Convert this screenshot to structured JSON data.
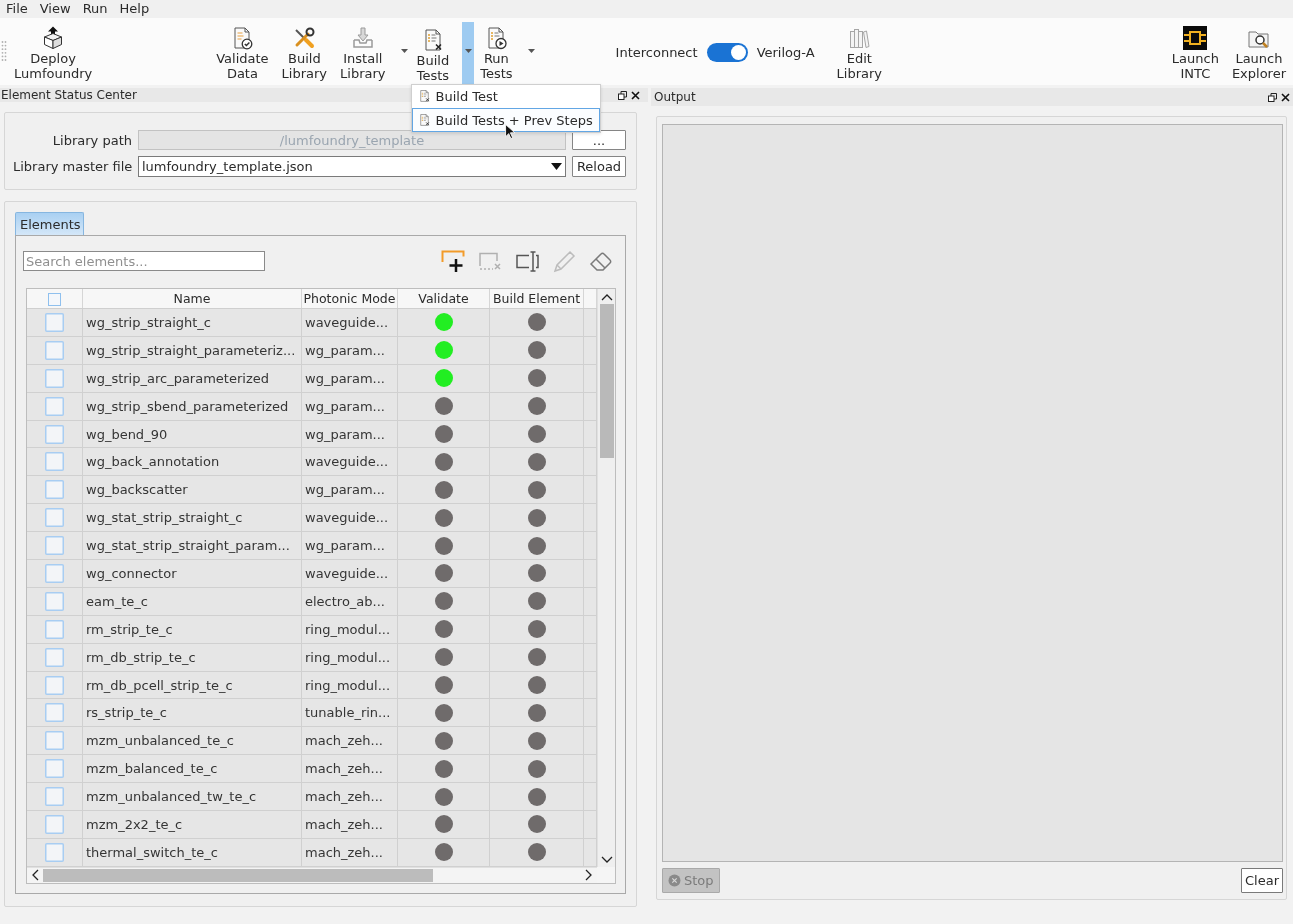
{
  "menu_bar": [
    {
      "label": "File"
    },
    {
      "label": "View"
    },
    {
      "label": "Run"
    },
    {
      "label": "Help"
    }
  ],
  "toolbar": {
    "items": [
      {
        "kind": "button",
        "label": "Deploy Lumfoundry"
      },
      {
        "kind": "button",
        "label": "Validate Data"
      },
      {
        "kind": "button",
        "label": "Build Library"
      },
      {
        "kind": "split",
        "label": "Install Library",
        "expanded": false
      },
      {
        "kind": "split",
        "label": "Build Tests",
        "expanded": true,
        "menu": [
          {
            "label": "Build Test",
            "selected": false
          },
          {
            "label": "Build Tests + Prev Steps",
            "selected": true
          }
        ]
      },
      {
        "kind": "split",
        "label": "Run Tests",
        "expanded": false
      },
      {
        "kind": "toggle",
        "left_label": "Interconnect",
        "right_label": "Verilog-A",
        "on": true
      },
      {
        "kind": "button",
        "label": "Edit Library"
      },
      {
        "kind": "button",
        "label": "Launch INTC"
      },
      {
        "kind": "button",
        "label": "Launch Explorer"
      }
    ]
  },
  "element_status_center": {
    "title": "Element Status Center",
    "library": {
      "path_label": "Library path",
      "path_field": {
        "value": "/lumfoundry_template",
        "disabled": true
      },
      "browse_button": "...",
      "master_label": "Library master file",
      "master_value": "lumfoundry_template.json",
      "reload_button": "Reload"
    },
    "elements": {
      "tabs": [
        {
          "label": "Elements",
          "selected": true
        }
      ],
      "search": {
        "placeholder": "Search elements..."
      },
      "tools": [
        {
          "disabled": false
        },
        {
          "disabled": true
        },
        {
          "disabled": false
        },
        {
          "disabled": true
        },
        {
          "disabled": false
        }
      ],
      "table": {
        "columns": [
          {
            "kind": "check",
            "checked": false
          },
          {
            "kind": "text",
            "label": "Name"
          },
          {
            "kind": "text",
            "label": "Photonic Mode"
          },
          {
            "kind": "status",
            "label": "Validate"
          },
          {
            "kind": "status",
            "label": "Build Element"
          }
        ],
        "rows": [
          {
            "checked": false,
            "name": "wg_strip_straight_c",
            "model": "waveguide...",
            "validate": {
              "color": "#22ee22"
            },
            "build": {
              "color": "#6f6b6b"
            }
          },
          {
            "checked": false,
            "name": "wg_strip_straight_parameteriz...",
            "model": "wg_param...",
            "validate": {
              "color": "#22ee22"
            },
            "build": {
              "color": "#6f6b6b"
            }
          },
          {
            "checked": false,
            "name": "wg_strip_arc_parameterized",
            "model": "wg_param...",
            "validate": {
              "color": "#22ee22"
            },
            "build": {
              "color": "#6f6b6b"
            }
          },
          {
            "checked": false,
            "name": "wg_strip_sbend_parameterized",
            "model": "wg_param...",
            "validate": {
              "color": "#6f6b6b"
            },
            "build": {
              "color": "#6f6b6b"
            }
          },
          {
            "checked": false,
            "name": "wg_bend_90",
            "model": "wg_param...",
            "validate": {
              "color": "#6f6b6b"
            },
            "build": {
              "color": "#6f6b6b"
            }
          },
          {
            "checked": false,
            "name": "wg_back_annotation",
            "model": "waveguide...",
            "validate": {
              "color": "#6f6b6b"
            },
            "build": {
              "color": "#6f6b6b"
            }
          },
          {
            "checked": false,
            "name": "wg_backscatter",
            "model": "wg_param...",
            "validate": {
              "color": "#6f6b6b"
            },
            "build": {
              "color": "#6f6b6b"
            }
          },
          {
            "checked": false,
            "name": "wg_stat_strip_straight_c",
            "model": "waveguide...",
            "validate": {
              "color": "#6f6b6b"
            },
            "build": {
              "color": "#6f6b6b"
            }
          },
          {
            "checked": false,
            "name": "wg_stat_strip_straight_param...",
            "model": "wg_param...",
            "validate": {
              "color": "#6f6b6b"
            },
            "build": {
              "color": "#6f6b6b"
            }
          },
          {
            "checked": false,
            "name": "wg_connector",
            "model": "waveguide...",
            "validate": {
              "color": "#6f6b6b"
            },
            "build": {
              "color": "#6f6b6b"
            }
          },
          {
            "checked": false,
            "name": "eam_te_c",
            "model": "electro_ab...",
            "validate": {
              "color": "#6f6b6b"
            },
            "build": {
              "color": "#6f6b6b"
            }
          },
          {
            "checked": false,
            "name": "rm_strip_te_c",
            "model": "ring_modul...",
            "validate": {
              "color": "#6f6b6b"
            },
            "build": {
              "color": "#6f6b6b"
            }
          },
          {
            "checked": false,
            "name": "rm_db_strip_te_c",
            "model": "ring_modul...",
            "validate": {
              "color": "#6f6b6b"
            },
            "build": {
              "color": "#6f6b6b"
            }
          },
          {
            "checked": false,
            "name": "rm_db_pcell_strip_te_c",
            "model": "ring_modul...",
            "validate": {
              "color": "#6f6b6b"
            },
            "build": {
              "color": "#6f6b6b"
            }
          },
          {
            "checked": false,
            "name": "rs_strip_te_c",
            "model": "tunable_rin...",
            "validate": {
              "color": "#6f6b6b"
            },
            "build": {
              "color": "#6f6b6b"
            }
          },
          {
            "checked": false,
            "name": "mzm_unbalanced_te_c",
            "model": "mach_zeh...",
            "validate": {
              "color": "#6f6b6b"
            },
            "build": {
              "color": "#6f6b6b"
            }
          },
          {
            "checked": false,
            "name": "mzm_balanced_te_c",
            "model": "mach_zeh...",
            "validate": {
              "color": "#6f6b6b"
            },
            "build": {
              "color": "#6f6b6b"
            }
          },
          {
            "checked": false,
            "name": "mzm_unbalanced_tw_te_c",
            "model": "mach_zeh...",
            "validate": {
              "color": "#6f6b6b"
            },
            "build": {
              "color": "#6f6b6b"
            }
          },
          {
            "checked": false,
            "name": "mzm_2x2_te_c",
            "model": "mach_zeh...",
            "validate": {
              "color": "#6f6b6b"
            },
            "build": {
              "color": "#6f6b6b"
            }
          },
          {
            "checked": false,
            "name": "thermal_switch_te_c",
            "model": "mach_zeh...",
            "validate": {
              "color": "#6f6b6b"
            },
            "build": {
              "color": "#6f6b6b"
            }
          }
        ]
      }
    }
  },
  "output": {
    "title": "Output",
    "stop_button": {
      "label": "Stop",
      "disabled": true
    },
    "clear_button": {
      "label": "Clear"
    }
  }
}
